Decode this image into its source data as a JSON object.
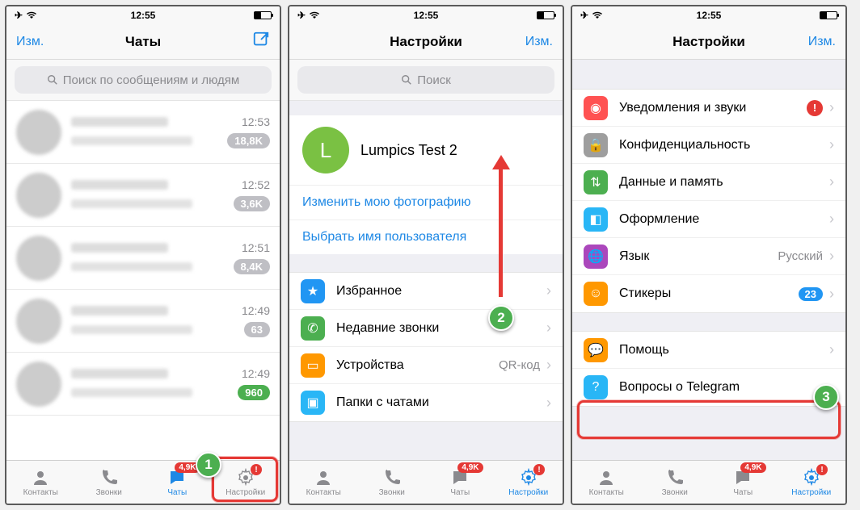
{
  "status": {
    "time": "12:55"
  },
  "screen1": {
    "nav": {
      "left": "Изм.",
      "title": "Чаты"
    },
    "search": "Поиск по сообщениям и людям",
    "chats": [
      {
        "time": "12:53",
        "badge": "18,8K"
      },
      {
        "time": "12:52",
        "badge": "3,6K"
      },
      {
        "time": "12:51",
        "badge": "8,4K"
      },
      {
        "time": "12:49",
        "badge": "63"
      },
      {
        "time": "12:49",
        "badge": "960"
      }
    ]
  },
  "screen2": {
    "nav": {
      "title": "Настройки",
      "right": "Изм."
    },
    "search": "Поиск",
    "profile": {
      "initial": "L",
      "name": "Lumpics Test 2"
    },
    "links": {
      "photo": "Изменить мою фотографию",
      "username": "Выбрать имя пользователя"
    },
    "items": [
      {
        "label": "Избранное"
      },
      {
        "label": "Недавние звонки"
      },
      {
        "label": "Устройства",
        "val": "QR-код"
      },
      {
        "label": "Папки с чатами"
      }
    ]
  },
  "screen3": {
    "nav": {
      "title": "Настройки",
      "right": "Изм."
    },
    "groupA": [
      {
        "label": "Уведомления и звуки",
        "alert": "!"
      },
      {
        "label": "Конфиденциальность"
      },
      {
        "label": "Данные и память"
      },
      {
        "label": "Оформление"
      },
      {
        "label": "Язык",
        "val": "Русский"
      },
      {
        "label": "Стикеры",
        "count": "23"
      }
    ],
    "groupB": [
      {
        "label": "Помощь"
      },
      {
        "label": "Вопросы о Telegram"
      }
    ]
  },
  "tabs": {
    "contacts": "Контакты",
    "calls": "Звонки",
    "chats": "Чаты",
    "settings": "Настройки",
    "chats_badge": "4,9K",
    "settings_alert": "!"
  },
  "steps": {
    "s1": "1",
    "s2": "2",
    "s3": "3"
  },
  "colors": {
    "favorites": "#2196f3",
    "calls": "#4caf50",
    "devices": "#ff9800",
    "folders": "#29b6f6",
    "notif": "#ff5252",
    "privacy": "#9e9e9e",
    "data": "#4caf50",
    "appearance": "#29b6f6",
    "lang": "#ab47bc",
    "stickers": "#ff9800",
    "help": "#ff9800",
    "faq": "#29b6f6"
  }
}
